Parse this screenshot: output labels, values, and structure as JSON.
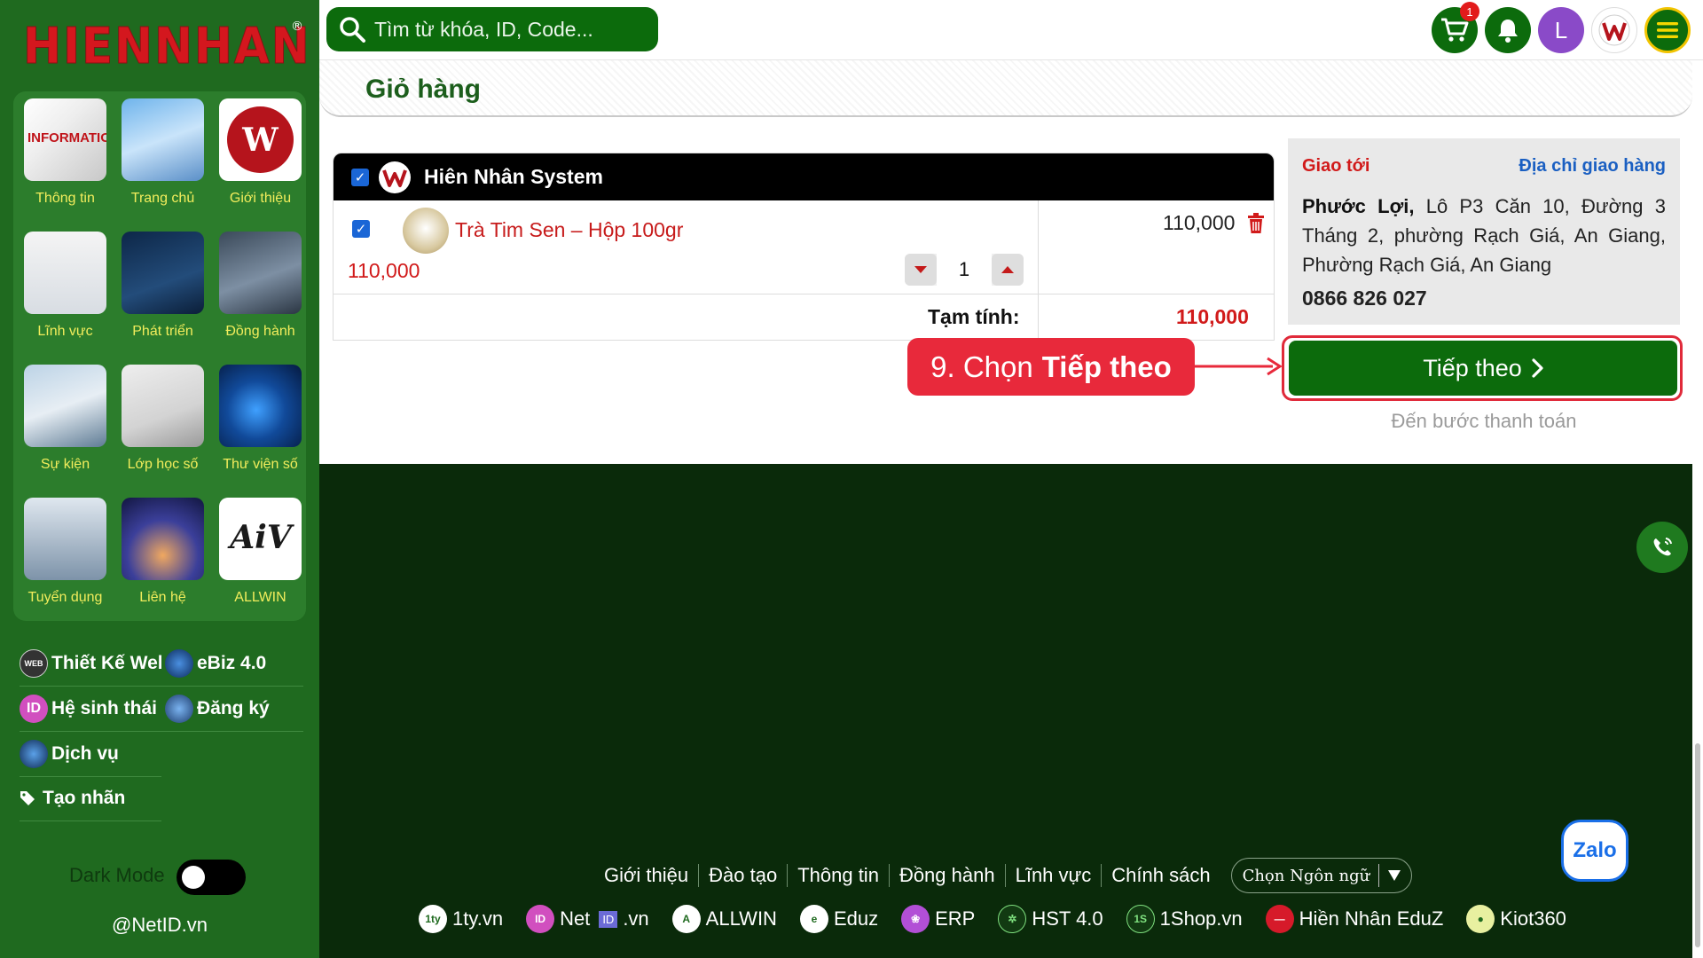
{
  "brand": {
    "logo_text": "HIENNHAN",
    "reg_mark": "®"
  },
  "search": {
    "placeholder": "Tìm từ khóa, ID, Code..."
  },
  "topbar": {
    "cart_count": "1",
    "avatar_letter": "L"
  },
  "sidebar": {
    "tiles": [
      {
        "label": "Thông tin",
        "icon": "information-image"
      },
      {
        "label": "Trang chủ",
        "icon": "building-image"
      },
      {
        "label": "Giới thiệu",
        "icon": "hiennhan-logo"
      },
      {
        "label": "Lĩnh vực",
        "icon": "sketch-image"
      },
      {
        "label": "Phát triển",
        "icon": "growth-image"
      },
      {
        "label": "Đồng hành",
        "icon": "handshake-image"
      },
      {
        "label": "Sự kiện",
        "icon": "meeting-image"
      },
      {
        "label": "Lớp học số",
        "icon": "classroom-image"
      },
      {
        "label": "Thư viện số",
        "icon": "digital-globe-image"
      },
      {
        "label": "Tuyển dụng",
        "icon": "recruit-image"
      },
      {
        "label": "Liên hệ",
        "icon": "contact-image"
      },
      {
        "label": "ALLWIN",
        "icon": "allwin-logo"
      }
    ],
    "links": [
      {
        "label": "Thiết Kế Web",
        "icon": "web-icon"
      },
      {
        "label": "eBiz 4.0",
        "icon": "globe-icon"
      },
      {
        "label": "Hệ sinh thái",
        "icon": "id-icon"
      },
      {
        "label": "Đăng ký",
        "icon": "globe-icon"
      },
      {
        "label": "Dịch vụ",
        "icon": "globe-icon"
      }
    ],
    "create_label": "Tạo nhãn",
    "dark_mode_label": "Dark Mode",
    "handle": "@NetID.vn"
  },
  "cart": {
    "title": "Giỏ hàng",
    "shop_name": "Hiên Nhân System",
    "item": {
      "name": "Trà Tim Sen – Hộp 100gr",
      "unit_price": "110,000",
      "total": "110,000",
      "quantity": "1"
    },
    "subtotal_label": "Tạm tính:",
    "subtotal_value": "110,000"
  },
  "shipping": {
    "heading": "Giao tới",
    "change_link": "Địa chỉ giao hàng",
    "name": "Phước Lợi,",
    "address": "Lô P3 Căn 10, Đường 3 Tháng 2, phường Rạch Giá, An Giang, Phường Rạch Giá, An Giang",
    "phone": "0866 826 027"
  },
  "checkout": {
    "next_label": "Tiếp theo",
    "hint": "Đến bước thanh toán"
  },
  "callout": {
    "prefix": "9. Chọn",
    "bold": "Tiếp theo"
  },
  "footer": {
    "links": [
      "Giới thiệu",
      "Đào tạo",
      "Thông tin",
      "Đồng hành",
      "Lĩnh vực",
      "Chính sách"
    ],
    "language_label": "Chọn Ngôn ngữ",
    "partners": [
      {
        "label": "1ty.vn",
        "icon": "1ty-icon"
      },
      {
        "label": "Net",
        "suffix": ".vn",
        "icon": "netid-icon"
      },
      {
        "label": "ALLWIN",
        "icon": "allwin-icon"
      },
      {
        "label": "Eduz",
        "icon": "eduz-icon"
      },
      {
        "label": "ERP",
        "icon": "erp-icon"
      },
      {
        "label": "HST 4.0",
        "icon": "hst-icon"
      },
      {
        "label": "1Shop.vn",
        "icon": "1shop-icon"
      },
      {
        "label": "Hiền Nhân EduZ",
        "icon": "hiennhan-eduz-icon"
      },
      {
        "label": "Kiot360",
        "icon": "kiot-icon"
      }
    ]
  },
  "zalo": {
    "label": "Zalo"
  },
  "colors": {
    "brand_green": "#1f6a1f",
    "dark_green": "#0a2a0a",
    "accent_red": "#e8293b",
    "price_red": "#d11a1a",
    "tile_label": "#f2ed5c"
  }
}
